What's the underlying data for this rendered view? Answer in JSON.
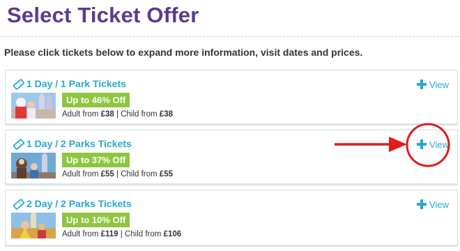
{
  "page": {
    "title": "Select Ticket Offer",
    "instructions": "Please click tickets below to expand more information, visit dates and prices."
  },
  "offers": [
    {
      "title": "1 Day / 1 Park Tickets",
      "discount": "Up to 46% Off",
      "adult_prefix": "Adult from ",
      "adult_price": "£38",
      "separator": " | ",
      "child_prefix": "Child from ",
      "child_price": "£38",
      "view_label": "View"
    },
    {
      "title": "1 Day / 2 Parks Tickets",
      "discount": "Up to 37% Off",
      "adult_prefix": "Adult from ",
      "adult_price": "£55",
      "separator": " | ",
      "child_prefix": "Child from ",
      "child_price": "£55",
      "view_label": "View"
    },
    {
      "title": "2 Day / 2 Parks Tickets",
      "discount": "Up to 10% Off",
      "adult_prefix": "Adult from ",
      "adult_price": "£119",
      "separator": " | ",
      "child_prefix": "Child from ",
      "child_price": "£106",
      "view_label": "View"
    }
  ],
  "colors": {
    "title": "#5b3a91",
    "accent": "#26a9cf",
    "badge": "#8dc63f",
    "annotation": "#e01b1b"
  },
  "icons": {
    "ticket": "ticket-icon",
    "view": "plus-icon"
  }
}
